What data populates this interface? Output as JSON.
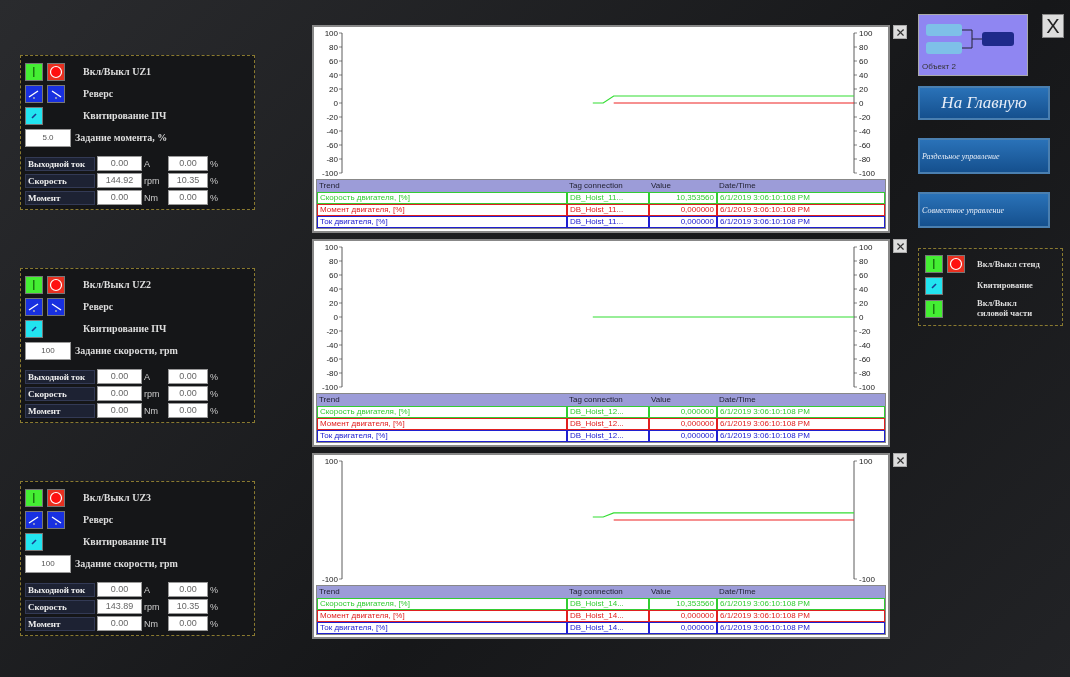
{
  "drives": [
    {
      "power_label": "Вкл/Выкл UZ1",
      "reverse_label": "Реверс",
      "ack_label": "Квитирование ПЧ",
      "setpoint": "5.0",
      "setpoint_label": "Задание момента, %",
      "readings": [
        {
          "label": "Выходной ток",
          "value": "0.00",
          "unit": "A",
          "percent": "0.00",
          "percent_unit": "%"
        },
        {
          "label": "Скорость",
          "value": "144.92",
          "unit": "rpm",
          "percent": "10.35",
          "percent_unit": "%"
        },
        {
          "label": "Момент",
          "value": "0.00",
          "unit": "Nm",
          "percent": "0.00",
          "percent_unit": "%"
        }
      ]
    },
    {
      "power_label": "Вкл/Выкл UZ2",
      "reverse_label": "Реверс",
      "ack_label": "Квитирование ПЧ",
      "setpoint": "100",
      "setpoint_label": "Задание скорости, rpm",
      "readings": [
        {
          "label": "Выходной ток",
          "value": "0.00",
          "unit": "A",
          "percent": "0.00",
          "percent_unit": "%"
        },
        {
          "label": "Скорость",
          "value": "0.00",
          "unit": "rpm",
          "percent": "0.00",
          "percent_unit": "%"
        },
        {
          "label": "Момент",
          "value": "0.00",
          "unit": "Nm",
          "percent": "0.00",
          "percent_unit": "%"
        }
      ]
    },
    {
      "power_label": "Вкл/Выкл UZ3",
      "reverse_label": "Реверс",
      "ack_label": "Квитирование ПЧ",
      "setpoint": "100",
      "setpoint_label": "Задание скорости, rpm",
      "readings": [
        {
          "label": "Выходной ток",
          "value": "0.00",
          "unit": "A",
          "percent": "0.00",
          "percent_unit": "%"
        },
        {
          "label": "Скорость",
          "value": "143.89",
          "unit": "rpm",
          "percent": "10.35",
          "percent_unit": "%"
        },
        {
          "label": "Момент",
          "value": "0.00",
          "unit": "Nm",
          "percent": "0.00",
          "percent_unit": "%"
        }
      ]
    }
  ],
  "trends": [
    {
      "chart_data": {
        "type": "line",
        "categories": [
          null,
          null,
          null,
          null,
          null,
          null,
          null,
          null,
          null,
          null,
          null,
          null,
          null,
          null,
          null,
          null,
          null,
          null,
          null,
          null,
          null,
          null,
          null,
          null,
          null,
          null,
          null,
          null,
          null,
          null,
          null,
          null,
          null,
          null,
          null,
          null,
          null,
          null,
          null,
          null,
          null,
          null,
          null,
          null,
          null,
          null,
          null,
          null,
          null,
          null
        ],
        "ylim": [
          -100,
          100
        ],
        "yticks": [
          100,
          80,
          60,
          40,
          20,
          0,
          -20,
          -40,
          -60,
          -80,
          -100
        ],
        "series": [
          {
            "color": "#ee2222",
            "values": [
              null,
              null,
              null,
              null,
              null,
              null,
              null,
              null,
              null,
              null,
              null,
              null,
              null,
              null,
              null,
              null,
              null,
              null,
              null,
              null,
              null,
              null,
              null,
              null,
              null,
              null,
              0,
              0,
              0,
              0,
              0,
              0,
              0,
              0,
              0,
              0,
              0,
              0,
              0,
              0,
              0,
              0,
              0,
              0,
              0,
              0,
              0,
              0,
              0,
              0
            ]
          },
          {
            "color": "#33dd33",
            "values": [
              null,
              null,
              null,
              null,
              null,
              null,
              null,
              null,
              null,
              null,
              null,
              null,
              null,
              null,
              null,
              null,
              null,
              null,
              null,
              null,
              null,
              null,
              null,
              null,
              0,
              0,
              10,
              10,
              10,
              10,
              10,
              10,
              10,
              10,
              10,
              10,
              10,
              10,
              10,
              10,
              10,
              10,
              10,
              10,
              10,
              10,
              10,
              10,
              10,
              10
            ]
          }
        ]
      },
      "legend": {
        "columns": [
          "Trend",
          "Tag connection",
          "Value",
          "Date/Time"
        ],
        "rows": [
          {
            "trend": "Скорость двигателя, [%]",
            "tag": "DB_Hoist_11...",
            "value": "10,353560",
            "time": "6/1/2019 3:06:10:108 PM",
            "color": "#33cc33"
          },
          {
            "trend": "Момент двигателя, [%]",
            "tag": "DB_Hoist_11...",
            "value": "0,000000",
            "time": "6/1/2019 3:06:10:108 PM",
            "color": "#e02020"
          },
          {
            "trend": "Ток двигателя, [%]",
            "tag": "DB_Hoist_11...",
            "value": "0,000000",
            "time": "6/1/2019 3:06:10:108 PM",
            "color": "#2020d0"
          }
        ]
      },
      "left_axis_labels": [
        "100",
        "80",
        "60",
        "40",
        "20",
        "0",
        "-20",
        "-40",
        "-60",
        "-80",
        "-100"
      ]
    },
    {
      "chart_data": {
        "type": "line",
        "categories": [
          null,
          null,
          null,
          null,
          null,
          null,
          null,
          null,
          null,
          null,
          null,
          null,
          null,
          null,
          null,
          null,
          null,
          null,
          null,
          null,
          null,
          null,
          null,
          null,
          null,
          null,
          null,
          null,
          null,
          null,
          null,
          null,
          null,
          null,
          null,
          null,
          null,
          null,
          null,
          null,
          null,
          null,
          null,
          null,
          null,
          null,
          null,
          null,
          null,
          null
        ],
        "ylim": [
          -100,
          100
        ],
        "yticks": [
          100,
          80,
          60,
          40,
          20,
          0,
          -20,
          -40,
          -60,
          -80,
          -100
        ],
        "series": [
          {
            "color": "#33dd33",
            "values": [
              null,
              null,
              null,
              null,
              null,
              null,
              null,
              null,
              null,
              null,
              null,
              null,
              null,
              null,
              null,
              null,
              null,
              null,
              null,
              null,
              null,
              null,
              null,
              null,
              0,
              0,
              0,
              0,
              0,
              0,
              0,
              0,
              0,
              0,
              0,
              0,
              0,
              0,
              0,
              0,
              0,
              0,
              0,
              0,
              0,
              0,
              0,
              0,
              0,
              0
            ]
          }
        ]
      },
      "legend": {
        "columns": [
          "Trend",
          "Tag connection",
          "Value",
          "Date/Time"
        ],
        "rows": [
          {
            "trend": "Скорость двигателя, [%]",
            "tag": "DB_Hoist_12...",
            "value": "0,000000",
            "time": "6/1/2019 3:06:10:108 PM",
            "color": "#33cc33"
          },
          {
            "trend": "Момент двигателя, [%]",
            "tag": "DB_Hoist_12...",
            "value": "0,000000",
            "time": "6/1/2019 3:06:10:108 PM",
            "color": "#e02020"
          },
          {
            "trend": "Ток двигателя, [%]",
            "tag": "DB_Hoist_12...",
            "value": "0,000000",
            "time": "6/1/2019 3:06:10:108 PM",
            "color": "#2020d0"
          }
        ]
      },
      "left_axis_labels": [
        "100",
        "80",
        "60",
        "40",
        "20",
        "0",
        "-20",
        "-40",
        "-60",
        "-80",
        "-100"
      ]
    },
    {
      "chart_data": {
        "type": "line",
        "categories": [
          null,
          null,
          null,
          null,
          null,
          null,
          null,
          null,
          null,
          null,
          null,
          null,
          null,
          null,
          null,
          null,
          null,
          null,
          null,
          null,
          null,
          null,
          null,
          null,
          null,
          null,
          null,
          null,
          null,
          null,
          null,
          null,
          null,
          null,
          null,
          null,
          null,
          null,
          null,
          null,
          null,
          null,
          null,
          null,
          null,
          null,
          null,
          null,
          null,
          null
        ],
        "ylim": [
          -100,
          100
        ],
        "yticks": [
          100,
          -100
        ],
        "series": [
          {
            "color": "#ee2222",
            "values": [
              null,
              null,
              null,
              null,
              null,
              null,
              null,
              null,
              null,
              null,
              null,
              null,
              null,
              null,
              null,
              null,
              null,
              null,
              null,
              null,
              null,
              null,
              null,
              null,
              null,
              null,
              0,
              0,
              0,
              0,
              0,
              0,
              0,
              0,
              0,
              0,
              0,
              0,
              0,
              0,
              0,
              0,
              0,
              0,
              0,
              0,
              0,
              0,
              0,
              0
            ]
          },
          {
            "color": "#33dd33",
            "values": [
              null,
              null,
              null,
              null,
              null,
              null,
              null,
              null,
              null,
              null,
              null,
              null,
              null,
              null,
              null,
              null,
              null,
              null,
              null,
              null,
              null,
              null,
              null,
              null,
              5,
              5,
              12,
              12,
              12,
              12,
              12,
              12,
              12,
              12,
              12,
              12,
              12,
              12,
              12,
              12,
              12,
              12,
              12,
              12,
              12,
              12,
              12,
              12,
              12,
              12
            ]
          }
        ]
      },
      "legend": {
        "columns": [
          "Trend",
          "Tag connection",
          "Value",
          "Date/Time"
        ],
        "rows": [
          {
            "trend": "Скорость двигателя, [%]",
            "tag": "DB_Hoist_14...",
            "value": "10,353560",
            "time": "6/1/2019 3:06:10:108 PM",
            "color": "#33cc33"
          },
          {
            "trend": "Момент двигателя, [%]",
            "tag": "DB_Hoist_14...",
            "value": "0,000000",
            "time": "6/1/2019 3:06:10:108 PM",
            "color": "#e02020"
          },
          {
            "trend": "Ток двигателя, [%]",
            "tag": "DB_Hoist_14...",
            "value": "0,000000",
            "time": "6/1/2019 3:06:10:108 PM",
            "color": "#2020d0"
          }
        ]
      },
      "left_axis_labels": [
        "100",
        "-100"
      ]
    }
  ],
  "object_tile": {
    "caption": "Объект 2"
  },
  "exit_button": "X",
  "nav_buttons": [
    {
      "label": "На Главную",
      "kind": "main"
    },
    {
      "label": "Раздельное управление",
      "kind": "mode"
    },
    {
      "label": "Совместное управление",
      "kind": "mode"
    }
  ],
  "stand": {
    "power_label": "Вкл/Выкл стенд",
    "ack_label": "Квитирование",
    "power_part_label": "Вкл/Выкл силовой части"
  }
}
